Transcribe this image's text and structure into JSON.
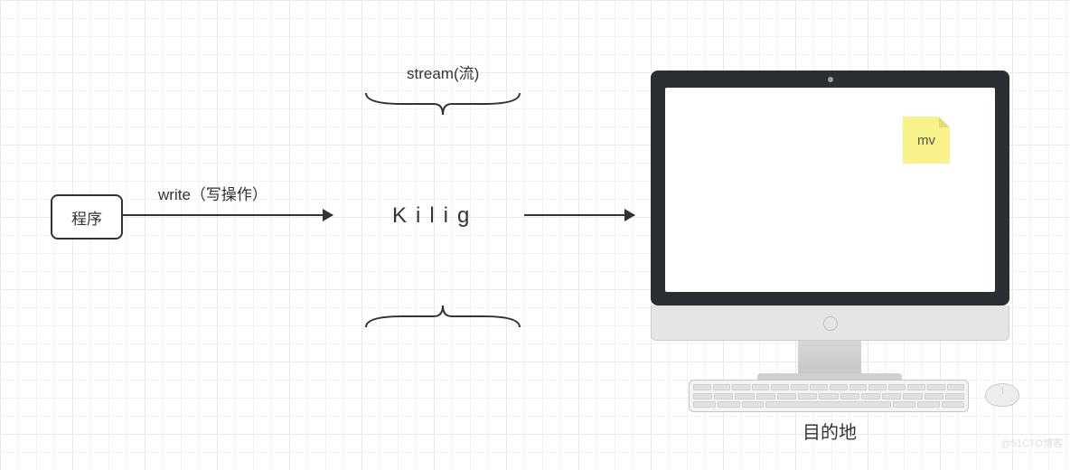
{
  "nodes": {
    "program": "程序",
    "stream_center": "Kilig",
    "destination": "目的地"
  },
  "labels": {
    "arrow_write": "write（写操作）",
    "stream_top": "stream(流)"
  },
  "screen": {
    "note_text": "mv"
  },
  "watermark": "@51CTO博客"
}
